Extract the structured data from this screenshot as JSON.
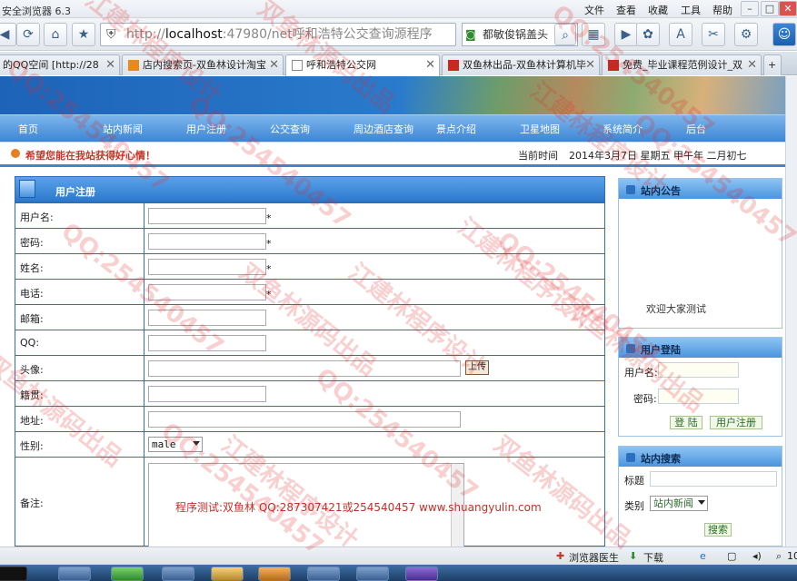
{
  "browser": {
    "title": "安全浏览器 6.3",
    "menu": [
      "文件",
      "查看",
      "收藏",
      "工具",
      "帮助"
    ],
    "url_scheme": "http://",
    "url_host": "localhost",
    "url_rest": ":47980/net呼和浩特公交查询源程序",
    "search_text": "都敏俊锅盖头",
    "tabs": [
      {
        "label": "的QQ空间 [http://28"
      },
      {
        "label": "店内搜索页-双鱼林设计淘宝"
      },
      {
        "label": "呼和浩特公交网"
      },
      {
        "label": "双鱼林出品-双鱼林计算机毕"
      },
      {
        "label": "免费_毕业课程范例设计_双"
      }
    ],
    "status": {
      "doctor": "浏览器医生",
      "download": "下载",
      "zoom": "10"
    }
  },
  "site": {
    "nav": [
      "首页",
      "站内新闻",
      "用户注册",
      "公交查询",
      "周边酒店查询",
      "景点介绍",
      "卫星地图",
      "系统简介",
      "后台"
    ],
    "greeting": "希望您能在我站获得好心情！",
    "date_label": "当前时间",
    "date": "2014年3月7日 星期五 甲午年 二月初七"
  },
  "register": {
    "title": "用户注册",
    "labels": {
      "username": "用户名:",
      "password": "密码:",
      "name": "姓名:",
      "phone": "电话:",
      "email": "邮箱:",
      "qq": "QQ:",
      "avatar": "头像:",
      "hometown": "籍贯:",
      "address": "地址:",
      "gender": "性别:",
      "notes": "备注:"
    },
    "required_mark": "*",
    "upload_label": "上传",
    "gender_value": "male",
    "credit": "程序测试:双鱼林 QQ:287307421或254540457 www.shuangyulin.com"
  },
  "sidebar": {
    "notice_title": "站内公告",
    "notice_text": "欢迎大家测试",
    "login_title": "用户登陆",
    "login_user_label": "用户名:",
    "login_pass_label": "密码:",
    "login_button": "登 陆",
    "register_button": "用户注册",
    "search_title": "站内搜索",
    "search_title_label": "标题",
    "search_type_label": "类别",
    "search_type_value": "站内新闻",
    "search_button": "搜索"
  },
  "watermarks": [
    "QQ:254540457",
    "双鱼林源码出品",
    "江建林程序设计"
  ]
}
